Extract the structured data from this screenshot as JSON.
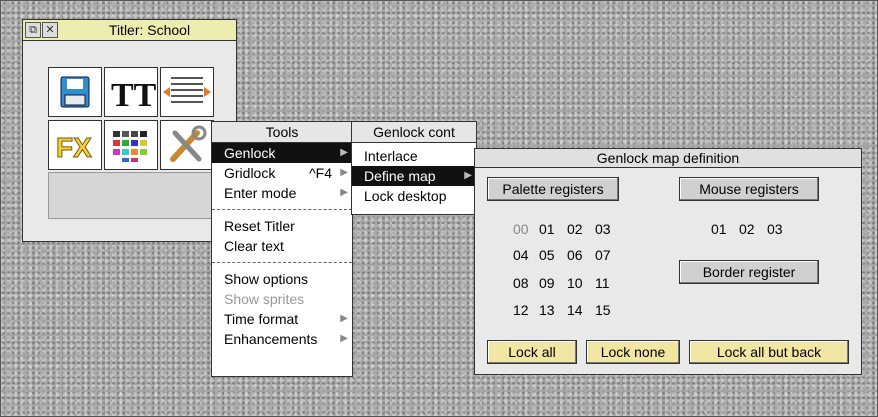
{
  "titler": {
    "title": "Titler: School",
    "tools": [
      {
        "name": "save-tool",
        "icon": "floppy-disk-icon"
      },
      {
        "name": "text-tool",
        "icon": "text-style-icon",
        "label": "TT"
      },
      {
        "name": "layout-tool",
        "icon": "page-layout-icon"
      },
      {
        "name": "effects-tool",
        "icon": "fx-icon",
        "label": "FX"
      },
      {
        "name": "palette-tool",
        "icon": "colour-grid-icon"
      },
      {
        "name": "settings-tool",
        "icon": "tools-icon"
      }
    ]
  },
  "tools_menu": {
    "title": "Tools",
    "items": [
      {
        "label": "Genlock",
        "submenu": true,
        "selected": true
      },
      {
        "label": "Gridlock",
        "shortcut": "^F4",
        "submenu": true
      },
      {
        "label": "Enter mode",
        "submenu": true
      },
      {
        "label": "Reset Titler"
      },
      {
        "label": "Clear text"
      },
      {
        "label": "Show options"
      },
      {
        "label": "Show sprites",
        "disabled": true
      },
      {
        "label": "Time format",
        "submenu": true
      },
      {
        "label": "Enhancements",
        "submenu": true
      }
    ]
  },
  "genlock_menu": {
    "title": "Genlock cont",
    "items": [
      {
        "label": "Interlace"
      },
      {
        "label": "Define map",
        "submenu": true,
        "selected": true
      },
      {
        "label": "Lock desktop"
      }
    ]
  },
  "genlock_dialog": {
    "title": "Genlock map definition",
    "palette_button": "Palette registers",
    "palette_rows": [
      [
        "00",
        "01",
        "02",
        "03"
      ],
      [
        "04",
        "05",
        "06",
        "07"
      ],
      [
        "08",
        "09",
        "10",
        "11"
      ],
      [
        "12",
        "13",
        "14",
        "15"
      ]
    ],
    "mouse_button": "Mouse registers",
    "mouse_values": [
      "01",
      "02",
      "03"
    ],
    "border_button": "Border register",
    "lock_all": "Lock all",
    "lock_none": "Lock none",
    "lock_all_but_back": "Lock all but back"
  },
  "colors": {
    "window_title": "#ededb0",
    "action_button": "#f2e6a5",
    "selection": "#111111"
  }
}
